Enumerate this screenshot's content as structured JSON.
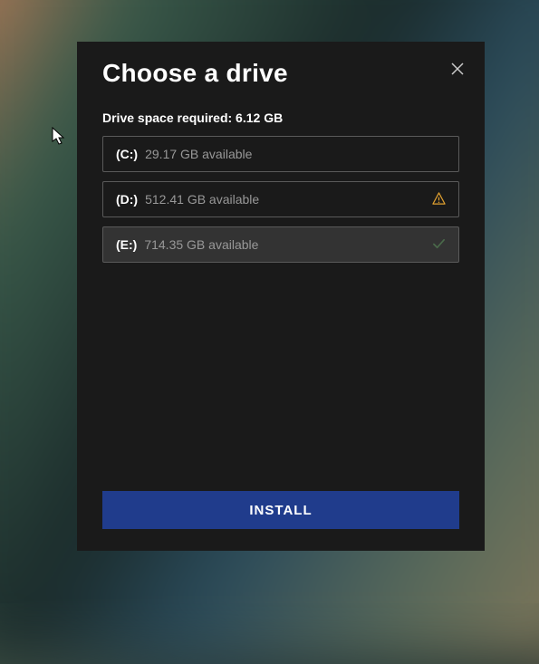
{
  "title": "Choose a drive",
  "space_required_label": "Drive space required: 6.12 GB",
  "drives": [
    {
      "letter": "(C:)",
      "available": "29.17 GB available",
      "status": "none",
      "selected": false
    },
    {
      "letter": "(D:)",
      "available": "512.41 GB available",
      "status": "warning",
      "selected": false
    },
    {
      "letter": "(E:)",
      "available": "714.35 GB available",
      "status": "check",
      "selected": true
    }
  ],
  "install_label": "INSTALL",
  "icons": {
    "close": "close-icon",
    "warning": "warning-icon",
    "check": "check-icon"
  },
  "colors": {
    "warning": "#e0a030",
    "check": "#3a5a3a",
    "install_bg": "#203c8c"
  }
}
